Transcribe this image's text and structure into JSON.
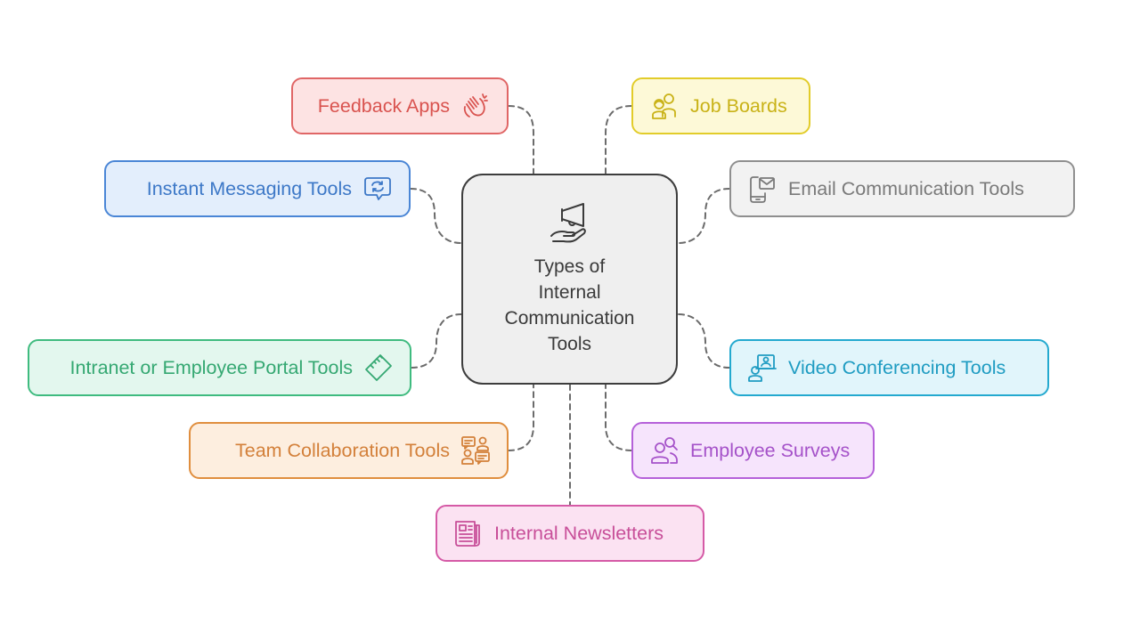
{
  "diagram": {
    "type": "mind-map",
    "center": {
      "title": "Types of Internal Communication Tools",
      "title_lines": [
        "Types of",
        "Internal",
        "Communication",
        "Tools"
      ],
      "icon": "megaphone-hand-icon",
      "colors": {
        "border": "#3d3d3d",
        "fill": "#efefef",
        "text": "#3a3a3a"
      }
    },
    "connector_color": "#6b6b6b",
    "branches": [
      {
        "id": "feedback",
        "label": "Feedback Apps",
        "icon": "clapping-hands-icon",
        "side": "left",
        "colors": {
          "border": "#e06666",
          "fill": "#fde3e3",
          "text": "#d9534f"
        }
      },
      {
        "id": "jobs",
        "label": "Job Boards",
        "icon": "people-group-icon",
        "side": "right",
        "colors": {
          "border": "#e2cc2a",
          "fill": "#fdf9d7",
          "text": "#c9b217"
        }
      },
      {
        "id": "im",
        "label": "Instant Messaging Tools",
        "icon": "chat-sync-icon",
        "side": "left",
        "colors": {
          "border": "#4a86d6",
          "fill": "#e3eefc",
          "text": "#3d78c7"
        }
      },
      {
        "id": "email",
        "label": "Email Communication Tools",
        "icon": "mobile-email-icon",
        "side": "right",
        "colors": {
          "border": "#8f8f8f",
          "fill": "#f2f2f2",
          "text": "#7a7a7a"
        }
      },
      {
        "id": "intranet",
        "label": "Intranet or Employee Portal Tools",
        "icon": "ruler-icon",
        "side": "left",
        "colors": {
          "border": "#3fbb7f",
          "fill": "#e3f7ee",
          "text": "#35a872"
        }
      },
      {
        "id": "video",
        "label": "Video Conferencing Tools",
        "icon": "video-presenter-icon",
        "side": "right",
        "colors": {
          "border": "#23a9cf",
          "fill": "#e1f5fb",
          "text": "#1f9cc2"
        }
      },
      {
        "id": "team",
        "label": "Team Collaboration Tools",
        "icon": "team-chat-icon",
        "side": "left",
        "colors": {
          "border": "#e08e3e",
          "fill": "#fdeedf",
          "text": "#d3803a"
        }
      },
      {
        "id": "surveys",
        "label": "Employee Surveys",
        "icon": "user-search-icon",
        "side": "right",
        "colors": {
          "border": "#b561d9",
          "fill": "#f6e4fc",
          "text": "#a552c9"
        }
      },
      {
        "id": "news",
        "label": "Internal Newsletters",
        "icon": "newspaper-icon",
        "side": "bottom",
        "colors": {
          "border": "#d55aa6",
          "fill": "#fbe2f2",
          "text": "#c84f99"
        }
      }
    ]
  }
}
